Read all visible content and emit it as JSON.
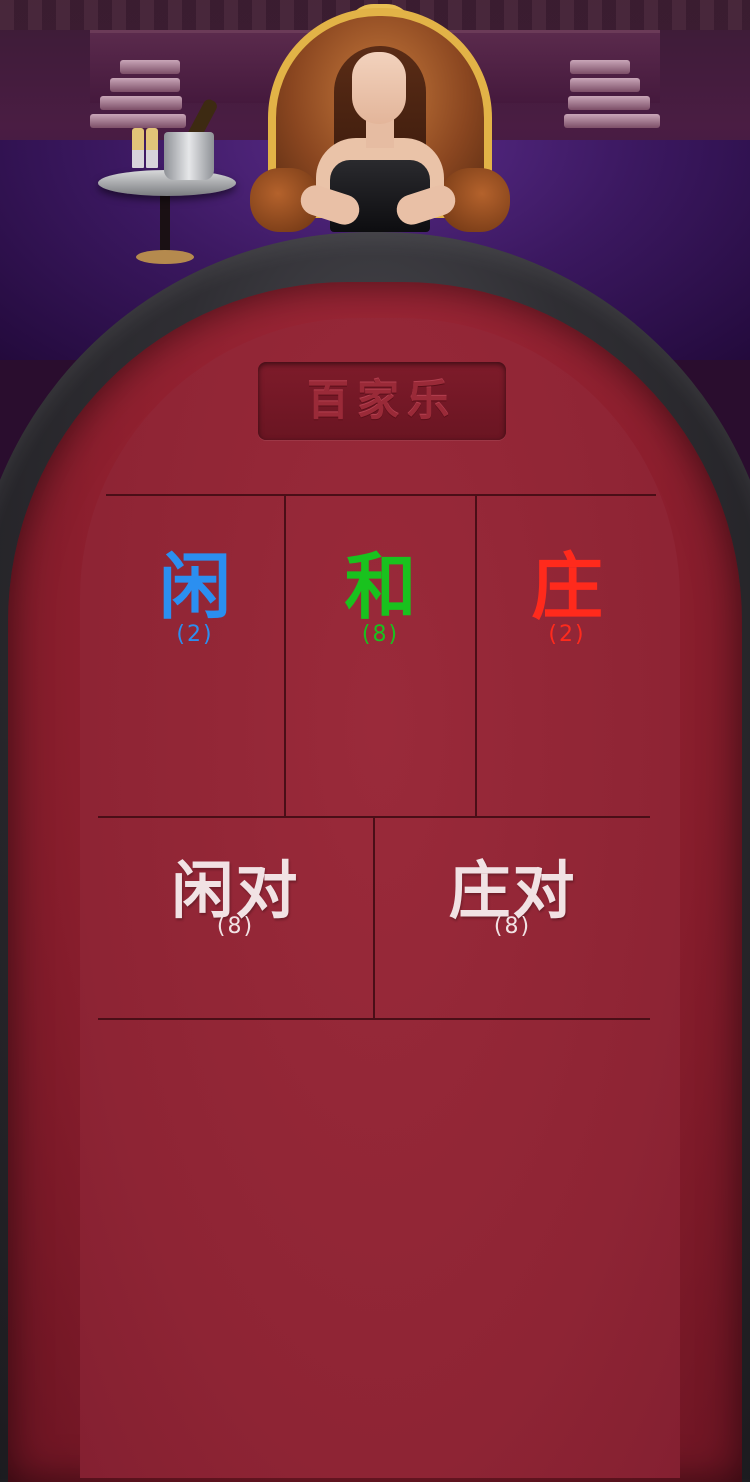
{
  "title": "百家乐",
  "bets": [
    {
      "label": "闲",
      "count": "(2)",
      "color": "#2b8ff0"
    },
    {
      "label": "和",
      "count": "(8)",
      "color": "#19c21e"
    },
    {
      "label": "庄",
      "count": "(2)",
      "color": "#ff2a1c"
    }
  ],
  "pairs": [
    {
      "label": "闲对",
      "count": "(8)"
    },
    {
      "label": "庄对",
      "count": "(8)"
    }
  ]
}
